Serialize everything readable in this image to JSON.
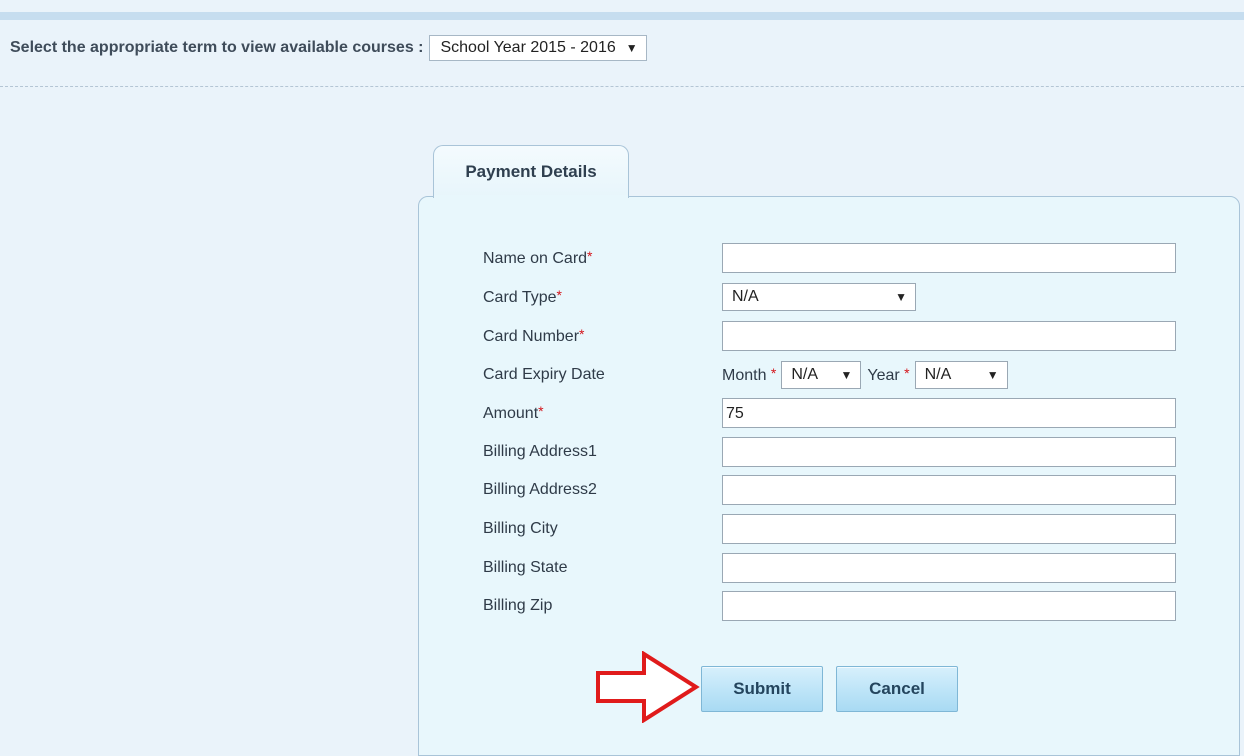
{
  "term": {
    "label": "Select the appropriate term to view available courses :",
    "selected": "School Year 2015 - 2016"
  },
  "tab": {
    "label": "Payment Details"
  },
  "form": {
    "name_on_card": {
      "label": "Name on Card",
      "value": ""
    },
    "card_type": {
      "label": "Card Type",
      "selected": "N/A"
    },
    "card_number": {
      "label": "Card Number",
      "value": ""
    },
    "expiry": {
      "label": "Card Expiry Date",
      "month_label": "Month",
      "month_selected": "N/A",
      "year_label": "Year",
      "year_selected": "N/A"
    },
    "amount": {
      "label": "Amount",
      "value": "75"
    },
    "billing_address1": {
      "label": "Billing Address1",
      "value": ""
    },
    "billing_address2": {
      "label": "Billing Address2",
      "value": ""
    },
    "billing_city": {
      "label": "Billing City",
      "value": ""
    },
    "billing_state": {
      "label": "Billing State",
      "value": ""
    },
    "billing_zip": {
      "label": "Billing Zip",
      "value": ""
    },
    "required_marker": "*"
  },
  "buttons": {
    "submit": "Submit",
    "cancel": "Cancel"
  },
  "icons": {
    "dropdown": "dropdown-arrow-icon",
    "callout": "red-outline-arrow-icon"
  },
  "colors": {
    "page_bg": "#eaf3fa",
    "panel_bg": "#e8f7fc",
    "required": "#d4151b",
    "callout_arrow": "#e01b1b",
    "button": "#bfe5f8"
  }
}
